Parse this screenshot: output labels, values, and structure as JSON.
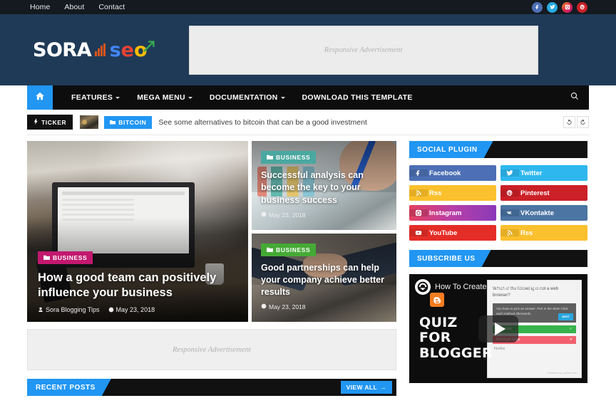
{
  "topbar": {
    "nav": [
      {
        "label": "Home"
      },
      {
        "label": "About"
      },
      {
        "label": "Contact"
      }
    ],
    "social": [
      {
        "name": "facebook",
        "glyph": "f",
        "color": "#4c6fb5"
      },
      {
        "name": "twitter",
        "glyph": "t",
        "color": "#28a9e0"
      },
      {
        "name": "instagram",
        "glyph": "i",
        "color": "#c9407e"
      },
      {
        "name": "pinterest",
        "glyph": "p",
        "color": "#cc2127"
      }
    ]
  },
  "header": {
    "logo": {
      "word1": "SORA",
      "word2_s": "s",
      "word2_e": "e",
      "word2_o": "o"
    },
    "ad_label": "Responsive Advertisement",
    "bg_color": "#1f3a57"
  },
  "mainnav": {
    "home_icon": "home-icon",
    "items": [
      {
        "label": "FEATURES",
        "has_dropdown": true
      },
      {
        "label": "MEGA MENU",
        "has_dropdown": true
      },
      {
        "label": "DOCUMENTATION",
        "has_dropdown": true
      },
      {
        "label": "DOWNLOAD THIS TEMPLATE",
        "has_dropdown": false
      }
    ],
    "search_icon": "search-icon",
    "accent": "#2196f3"
  },
  "ticker": {
    "badge": "TICKER",
    "category": "BITCOIN",
    "headline": "See some alternatives to bitcoin that can be a good investment",
    "prev_icon": "rotate-left-icon",
    "next_icon": "rotate-right-icon"
  },
  "featured": {
    "big": {
      "category": "BUSINESS",
      "category_color": "#c2186f",
      "title": "How a good team can positively influence your business",
      "author": "Sora Blogging Tips",
      "date": "May 23, 2018"
    },
    "small": [
      {
        "category": "BUSINESS",
        "category_color": "#4aa8a0",
        "title": "Successful analysis can become the key to your business success",
        "date": "May 23, 2018"
      },
      {
        "category": "BUSINESS",
        "category_color": "#45aa35",
        "title": "Good partnerships can help your company achieve better results",
        "date": "May 23, 2018"
      }
    ]
  },
  "body_ad": {
    "label": "Responsive Advertisement"
  },
  "recent": {
    "title": "RECENT POSTS",
    "view_all": "VIEW ALL"
  },
  "sidebar": {
    "social_widget": {
      "title": "SOCIAL PLUGIN",
      "buttons": [
        {
          "label": "Facebook",
          "icon": "facebook-icon",
          "color": "#4c6fb5",
          "icon_bg": "#44649f"
        },
        {
          "label": "Twitter",
          "icon": "twitter-icon",
          "color": "#2eb7ee",
          "icon_bg": "#27a6da"
        },
        {
          "label": "Rss",
          "icon": "rss-icon",
          "color": "#fbc02d",
          "icon_bg": "#e5ae24"
        },
        {
          "label": "Pinterest",
          "icon": "pinterest-icon",
          "color": "#cb2027",
          "icon_bg": "#b61c22"
        },
        {
          "label": "Instagram",
          "icon": "instagram-icon",
          "color": "linear-gradient(90deg,#e4405f,#b73fa8,#8a3ab9)",
          "icon_bg": "rgba(0,0,0,.12)"
        },
        {
          "label": "VKontakte",
          "icon": "vk-icon",
          "color": "#4c75a3",
          "icon_bg": "#416690"
        },
        {
          "label": "YouTube",
          "icon": "youtube-icon",
          "color": "#e52d27",
          "icon_bg": "#cd2823"
        },
        {
          "label": "Rss",
          "icon": "rss-icon",
          "color": "#fbc02d",
          "icon_bg": "#e5ae24"
        }
      ]
    },
    "subscribe_widget": {
      "title": "SUBSCRIBE US",
      "video": {
        "title": "How To Create A Quiz For Yo...",
        "overlay_line1": "QUIZ",
        "overlay_line2": "FOR",
        "overlay_line3": "BLOGGER",
        "play_icon": "play-button-icon",
        "menu_icon": "kebab-menu-icon",
        "quiz_question": "Which of the following is not a web browser?",
        "quiz_hint": "You have to pick an answer. Pick in the slide! Click each method afterwards.",
        "quiz_next": "NEXT",
        "quiz_option_correct": "Facebook",
        "quiz_option_wrong": "Microsoft Edge",
        "quiz_option_plain": "Firefox",
        "quiz_footer": "Powered by online.com"
      }
    }
  }
}
